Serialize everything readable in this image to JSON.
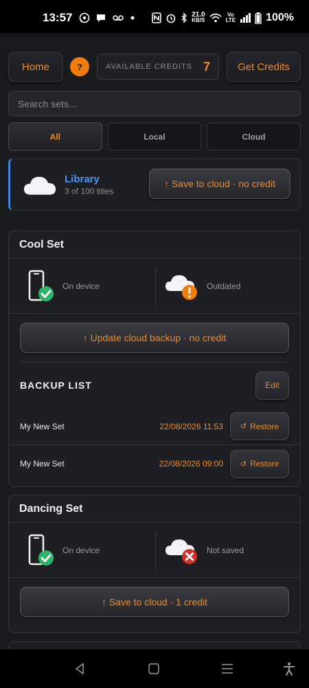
{
  "status_bar": {
    "time": "13:57",
    "net_speed_top": "21.0",
    "net_speed_bottom": "KB/S",
    "lte_top": "Vo",
    "lte_bottom": "LTE",
    "battery": "100%"
  },
  "header": {
    "home_label": "Home",
    "help_label": "?",
    "credits_label": "AVAILABLE CREDITS",
    "credits_value": "7",
    "get_credits_label": "Get Credits"
  },
  "search": {
    "placeholder": "Search sets..."
  },
  "tabs": [
    {
      "label": "All",
      "active": true
    },
    {
      "label": "Local",
      "active": false
    },
    {
      "label": "Cloud",
      "active": false
    }
  ],
  "library": {
    "title": "Library",
    "subtitle": "3 of 100 titles",
    "button_label": "↑ Save to cloud · no credit"
  },
  "sets": [
    {
      "name": "Cool Set",
      "device_status": "On device",
      "cloud_status": "Outdated",
      "action_label": "↑ Update cloud backup · no credit",
      "backup_list_title": "BACKUP LIST",
      "edit_label": "Edit",
      "backups": [
        {
          "name": "My New Set",
          "date": "22/08/2026 11:53",
          "restore_label": "Restore"
        },
        {
          "name": "My New Set",
          "date": "22/08/2026 09:00",
          "restore_label": "Restore"
        }
      ]
    },
    {
      "name": "Dancing Set",
      "device_status": "On device",
      "cloud_status": "Not saved",
      "action_label": "↑ Save to cloud · 1 credit"
    }
  ],
  "colors": {
    "accent": "#f08a24",
    "library_blue": "#4a96f0",
    "success": "#2fb56a",
    "warning": "#f07c10",
    "error": "#d0302a"
  },
  "icons": {
    "device": "phone-icon",
    "cloud": "cloud-icon",
    "check": "check-badge-icon",
    "warning": "exclamation-badge-icon",
    "error": "x-badge-icon",
    "restore": "restore-icon"
  }
}
